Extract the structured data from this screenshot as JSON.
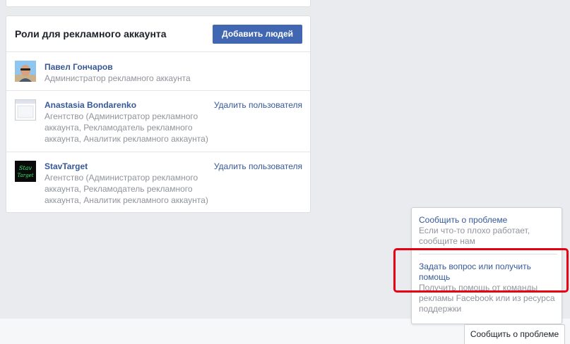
{
  "roles_card": {
    "title": "Роли для рекламного аккаунта",
    "add_button_label": "Добавить людей",
    "users": [
      {
        "name": "Павел Гончаров",
        "role": "Администратор рекламного аккаунта",
        "avatar_icon": "user-photo"
      },
      {
        "name": "Anastasia Bondarenko",
        "role": "Агентство (Администратор рекламного аккаунта, Рекламодатель рекламного аккаунта, Аналитик рекламного аккаунта)",
        "remove_label": "Удалить пользователя",
        "avatar_icon": "page-placeholder-icon"
      },
      {
        "name": "StavTarget",
        "role": "Агентство (Администратор рекламного аккаунта, Рекламодатель рекламного аккаунта, Аналитик рекламного аккаунта)",
        "remove_label": "Удалить пользователя",
        "avatar_icon": "stavtarget-logo",
        "avatar_text": "Stav Target"
      }
    ]
  },
  "help_popup": {
    "items": [
      {
        "title": "Сообщить о проблеме",
        "description": "Если что-то плохо работает, сообщите нам"
      },
      {
        "title": "Задать вопрос или получить помощь",
        "description": "Получить помощь от команды рекламы Facebook или из ресурса поддержки"
      }
    ]
  },
  "report_button_label": "Сообщить о проблеме",
  "colors": {
    "accent": "#4267b2",
    "link": "#365899",
    "muted": "#90949c",
    "highlight": "#e60012"
  }
}
